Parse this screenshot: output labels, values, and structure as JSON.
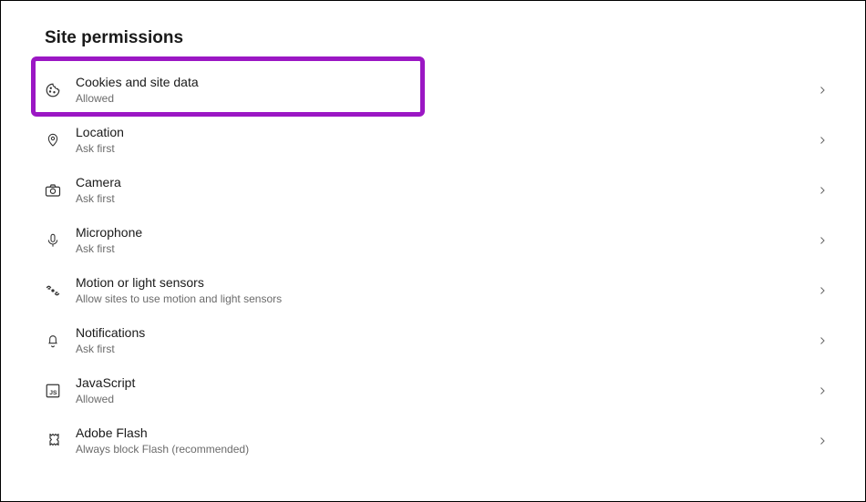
{
  "title": "Site permissions",
  "items": [
    {
      "label": "Cookies and site data",
      "status": "Allowed"
    },
    {
      "label": "Location",
      "status": "Ask first"
    },
    {
      "label": "Camera",
      "status": "Ask first"
    },
    {
      "label": "Microphone",
      "status": "Ask first"
    },
    {
      "label": "Motion or light sensors",
      "status": "Allow sites to use motion and light sensors"
    },
    {
      "label": "Notifications",
      "status": "Ask first"
    },
    {
      "label": "JavaScript",
      "status": "Allowed"
    },
    {
      "label": "Adobe Flash",
      "status": "Always block Flash (recommended)"
    }
  ]
}
